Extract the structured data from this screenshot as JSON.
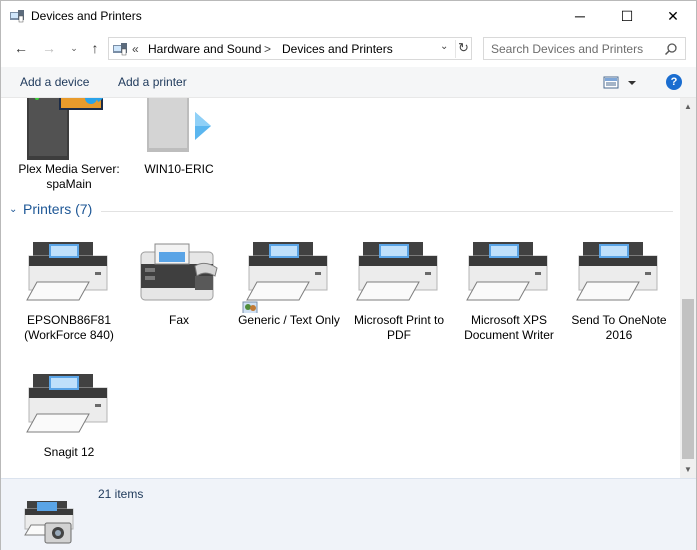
{
  "window": {
    "title": "Devices and Printers",
    "controls": {
      "minimize": "─",
      "maximize": "☐",
      "close": "✕"
    }
  },
  "nav": {
    "back": "←",
    "forward": "→",
    "recent": "⌄",
    "up": "↑",
    "address": {
      "overflow": "«",
      "crumbs": [
        "Hardware and Sound",
        "Devices and Printers"
      ],
      "separator": ">",
      "dropdown": "⌄",
      "refresh": "↻"
    },
    "search": {
      "placeholder": "Search Devices and Printers"
    }
  },
  "commands": {
    "add_device": "Add a device",
    "add_printer": "Add a printer",
    "help": "?"
  },
  "media_devices": [
    {
      "label": "Plex Media Server: spaMain"
    },
    {
      "label": "WIN10-ERIC"
    }
  ],
  "printers_group": {
    "chevron": "⌄",
    "title": "Printers (7)",
    "items": [
      {
        "label": "EPSONB86F81 (WorkForce 840)"
      },
      {
        "label": "Fax"
      },
      {
        "label": "Generic / Text Only"
      },
      {
        "label": "Microsoft Print to PDF"
      },
      {
        "label": "Microsoft XPS Document Writer"
      },
      {
        "label": "Send To OneNote 2016"
      },
      {
        "label": "Snagit 12"
      }
    ]
  },
  "scrollbar": {
    "up": "▲",
    "down": "▼"
  },
  "status": {
    "count": "21 items"
  },
  "colors": {
    "link": "#1e395b",
    "group": "#1e5796",
    "status_bg": "#f0f3f9"
  }
}
